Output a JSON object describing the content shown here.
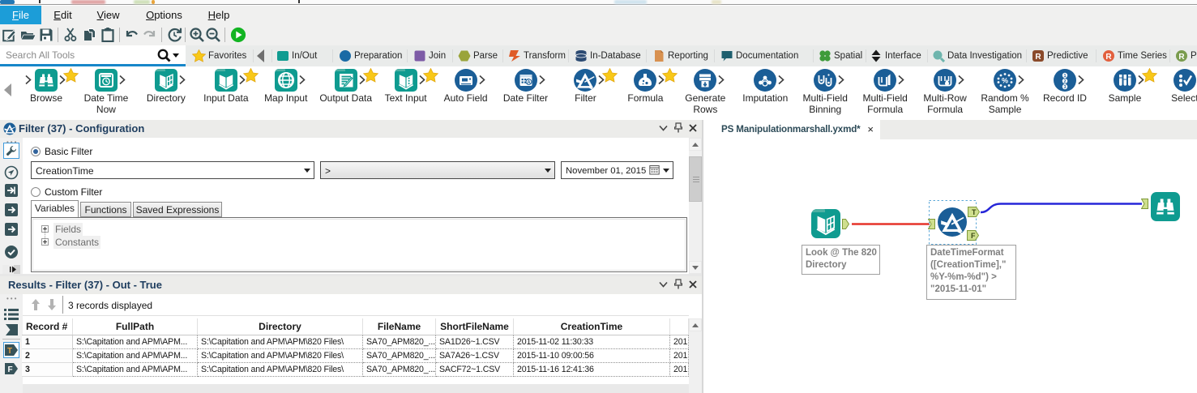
{
  "colors": {
    "accent_blue": "#1c9dd8",
    "tool_teal": "#0f9b90",
    "tool_blue": "#1b5e97",
    "icon_slate": "#37535a",
    "run_green": "#12b422",
    "star_yellow": "#f8c818",
    "wire_red": "#e5342a",
    "wire_blue": "#2626d8",
    "anchor_green": "#cfdf8e"
  },
  "menubar": {
    "items": [
      {
        "label": "File",
        "active": true
      },
      {
        "label": "Edit",
        "active": false
      },
      {
        "label": "View",
        "active": false
      },
      {
        "label": "Options",
        "active": false
      },
      {
        "label": "Help",
        "active": false
      }
    ]
  },
  "toolbar": {
    "buttons": [
      "new",
      "open",
      "save",
      "cut",
      "copy",
      "paste",
      "undo",
      "redo",
      "refresh",
      "zoom-in",
      "zoom-out",
      "run"
    ]
  },
  "search": {
    "placeholder": "Search All Tools"
  },
  "categories": {
    "items": [
      {
        "label": "Favorites",
        "icon": "star"
      },
      {
        "label": "In/Out",
        "icon": "inout"
      },
      {
        "label": "Preparation",
        "icon": "preparation"
      },
      {
        "label": "Join",
        "icon": "join"
      },
      {
        "label": "Parse",
        "icon": "parse"
      },
      {
        "label": "Transform",
        "icon": "transform"
      },
      {
        "label": "In-Database",
        "icon": "indb"
      },
      {
        "label": "Reporting",
        "icon": "reporting"
      },
      {
        "label": "Documentation",
        "icon": "documentation"
      },
      {
        "label": "Spatial",
        "icon": "spatial"
      },
      {
        "label": "Interface",
        "icon": "interface"
      },
      {
        "label": "Data Investigation",
        "icon": "datainvestigation"
      },
      {
        "label": "Predictive",
        "icon": "predictive"
      },
      {
        "label": "Time Series",
        "icon": "timeseries"
      },
      {
        "label": "P",
        "icon": "prescriptive"
      }
    ]
  },
  "palette": {
    "tools": [
      {
        "lines": [
          "Browse"
        ],
        "icon": "browse",
        "color": "teal",
        "star": true
      },
      {
        "lines": [
          "Date Time",
          "Now"
        ],
        "icon": "datetimenow",
        "color": "teal",
        "star": false
      },
      {
        "lines": [
          "Directory"
        ],
        "icon": "directory",
        "color": "teal",
        "star": false
      },
      {
        "lines": [
          "Input Data"
        ],
        "icon": "inputdata",
        "color": "teal",
        "star": true
      },
      {
        "lines": [
          "Map Input"
        ],
        "icon": "mapinput",
        "color": "teal",
        "star": false
      },
      {
        "lines": [
          "Output Data"
        ],
        "icon": "outputdata",
        "color": "teal",
        "star": true
      },
      {
        "lines": [
          "Text Input"
        ],
        "icon": "textinput",
        "color": "teal",
        "star": true
      },
      {
        "lines": [
          "Auto Field"
        ],
        "icon": "autofield",
        "color": "blue",
        "star": false
      },
      {
        "lines": [
          "Date Filter"
        ],
        "icon": "datefilter",
        "color": "blue",
        "star": false
      },
      {
        "lines": [
          "Filter"
        ],
        "icon": "filter",
        "color": "blue",
        "star": true
      },
      {
        "lines": [
          "Formula"
        ],
        "icon": "formula",
        "color": "blue",
        "star": true
      },
      {
        "lines": [
          "Generate",
          "Rows"
        ],
        "icon": "generaterows",
        "color": "blue",
        "star": false
      },
      {
        "lines": [
          "Imputation"
        ],
        "icon": "imputation",
        "color": "blue",
        "star": false
      },
      {
        "lines": [
          "Multi-Field",
          "Binning"
        ],
        "icon": "multifieldbinning",
        "color": "blue",
        "star": false
      },
      {
        "lines": [
          "Multi-Field",
          "Formula"
        ],
        "icon": "multifieldformula",
        "color": "blue",
        "star": false
      },
      {
        "lines": [
          "Multi-Row",
          "Formula"
        ],
        "icon": "multirowformula",
        "color": "blue",
        "star": false
      },
      {
        "lines": [
          "Random %",
          "Sample"
        ],
        "icon": "randomsample",
        "color": "blue",
        "star": false
      },
      {
        "lines": [
          "Record ID"
        ],
        "icon": "recordid",
        "color": "blue",
        "star": false
      },
      {
        "lines": [
          "Sample"
        ],
        "icon": "sample",
        "color": "blue",
        "star": true
      },
      {
        "lines": [
          "Select"
        ],
        "icon": "select",
        "color": "blue",
        "star": false
      }
    ]
  },
  "config_panel": {
    "title": "Filter (37) - Configuration",
    "basic_filter_label": "Basic Filter",
    "custom_filter_label": "Custom Filter",
    "field_value": "CreationTime",
    "operator_value": ">",
    "date_value": "November 01, 2015",
    "tabs": [
      "Variables",
      "Functions",
      "Saved Expressions"
    ],
    "tree_items": [
      "Fields",
      "Constants"
    ]
  },
  "results_panel": {
    "title": "Results - Filter (37) - Out - True",
    "status": "3 records displayed",
    "table": {
      "columns": [
        "Record #",
        "FullPath",
        "Directory",
        "FileName",
        "ShortFileName",
        "CreationTime",
        ""
      ],
      "rows": [
        [
          "1",
          "S:\\Capitation and APM\\APM...",
          "S:\\Capitation and APM\\APM\\820 Files\\",
          "SA70_APM820_...",
          "SA1D26~1.CSV",
          "2015-11-02 11:30:33",
          "201"
        ],
        [
          "2",
          "S:\\Capitation and APM\\APM...",
          "S:\\Capitation and APM\\APM\\820 Files\\",
          "SA70_APM820_...",
          "SA7A26~1.CSV",
          "2015-11-10 09:00:56",
          "201"
        ],
        [
          "3",
          "S:\\Capitation and APM\\APM...",
          "S:\\Capitation and APM\\APM\\820 Files\\",
          "SA70_APM820_...",
          "SACF72~1.CSV",
          "2015-11-16 12:41:36",
          "201"
        ]
      ]
    }
  },
  "canvas": {
    "tab": "PS Manipulationmarshall.yxmd*",
    "nodes": [
      {
        "name": "directory-tool"
      },
      {
        "name": "filter-tool"
      },
      {
        "name": "browse-tool"
      }
    ],
    "anchors": {
      "true_label": "T",
      "false_label": "F"
    },
    "annotations": [
      {
        "lines": [
          "Look @ The 820",
          "Directory"
        ]
      },
      {
        "lines": [
          "DateTimeFormat",
          "([CreationTime],\"",
          "%Y-%m-%d\") >",
          "\"2015-11-01\""
        ]
      }
    ]
  }
}
